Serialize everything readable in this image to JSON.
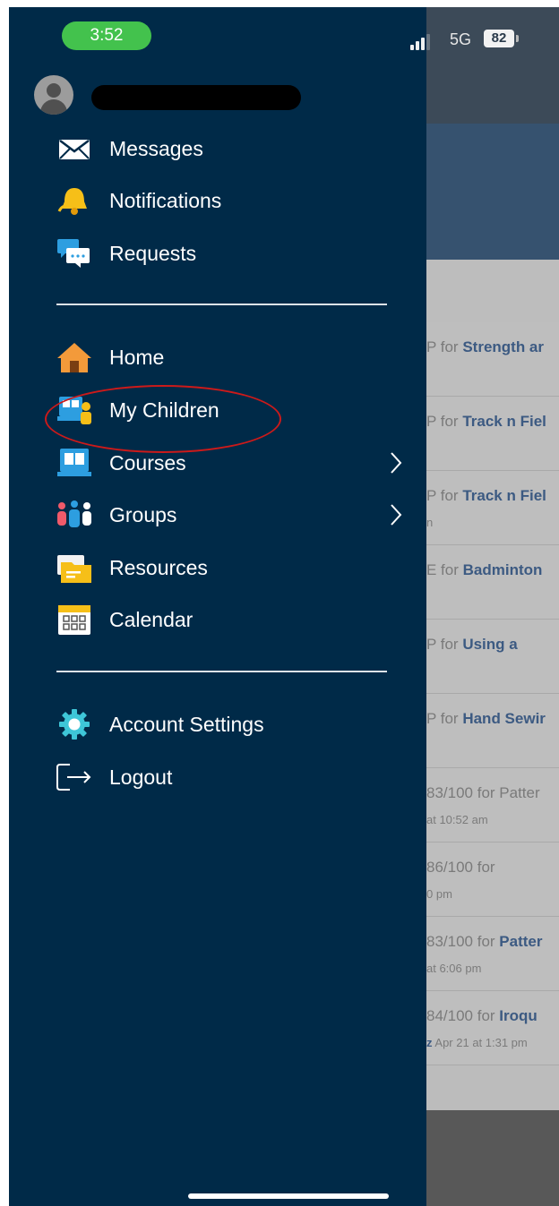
{
  "status_bar": {
    "time": "3:52",
    "network": "5G",
    "battery": "82"
  },
  "menu": {
    "messages": "Messages",
    "notifications": "Notifications",
    "requests": "Requests",
    "home": "Home",
    "my_children": "My Children",
    "courses": "Courses",
    "groups": "Groups",
    "resources": "Resources",
    "calendar": "Calendar",
    "account_settings": "Account Settings",
    "logout": "Logout"
  },
  "icons": {
    "messages": "envelope-icon",
    "notifications": "bell-icon",
    "requests": "chat-bubbles-icon",
    "home": "house-icon",
    "my_children": "children-icon",
    "courses": "book-icon",
    "groups": "people-icon",
    "resources": "folders-icon",
    "calendar": "calendar-icon",
    "account_settings": "gear-icon",
    "logout": "logout-arrow-icon",
    "chevron": "chevron-right-icon"
  },
  "background_feed": [
    {
      "prefix": "P for",
      "title": "Strength ar",
      "sub_bold": "",
      "sub": ""
    },
    {
      "prefix": "P for",
      "title": "Track n Fiel",
      "sub_bold": "",
      "sub": ""
    },
    {
      "prefix": "P for",
      "title": "Track n Fiel",
      "sub_bold": "",
      "sub": "n"
    },
    {
      "prefix": "E for",
      "title": "Badminton",
      "sub_bold": "",
      "sub": ""
    },
    {
      "prefix": "P for",
      "title": "Using a",
      "sub_bold": "",
      "sub": ""
    },
    {
      "prefix": "P for",
      "title": "Hand Sewir",
      "sub_bold": "",
      "sub": ""
    },
    {
      "prefix": "83/100 for Patter",
      "title": "",
      "sub_bold": "",
      "sub": "at 10:52 am"
    },
    {
      "prefix": "86/100 for",
      "title": "",
      "sub_bold": "",
      "sub": "0 pm"
    },
    {
      "prefix": "83/100 for",
      "title": "Patter",
      "sub_bold": "",
      "sub": "at 6:06 pm"
    },
    {
      "prefix": "84/100 for",
      "title": "Iroqu",
      "sub_bold": "z",
      "sub": "Apr 21 at 1:31 pm"
    }
  ],
  "colors": {
    "drawer_bg": "#002a48",
    "time_pill": "#43c24d",
    "highlight_ring": "#cc1a1a",
    "link_blue": "#3c5a82"
  }
}
